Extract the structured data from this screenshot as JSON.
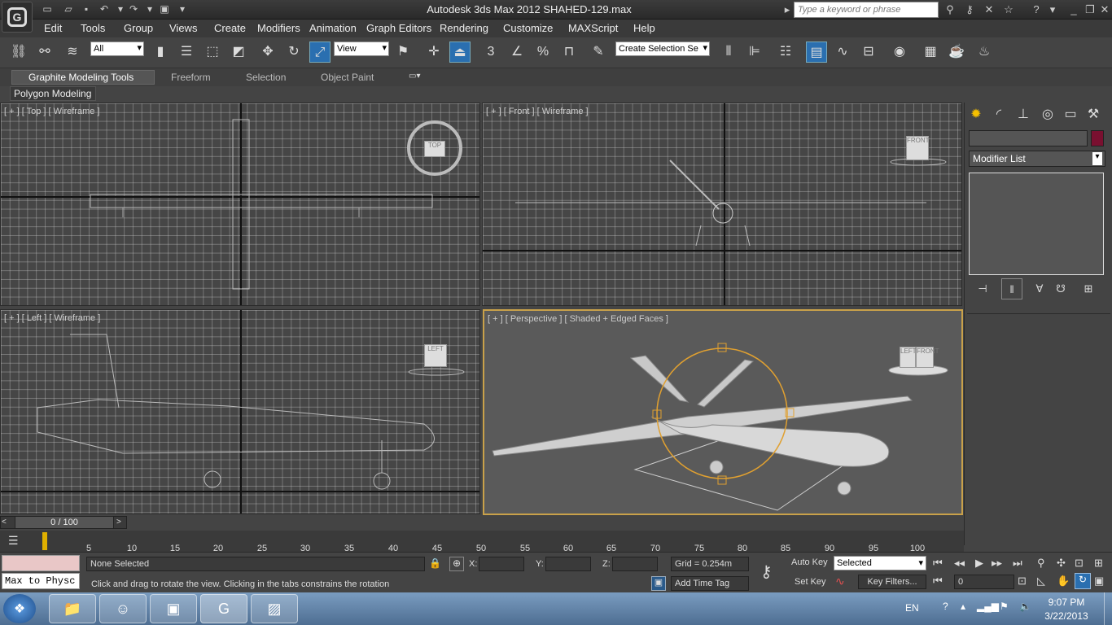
{
  "title": {
    "app": "Autodesk 3ds Max  2012",
    "file": "SHAHED-129.max",
    "search_placeholder": "Type a keyword or phrase"
  },
  "menu": [
    "Edit",
    "Tools",
    "Group",
    "Views",
    "Create",
    "Modifiers",
    "Animation",
    "Graph Editors",
    "Rendering",
    "Customize",
    "MAXScript",
    "Help"
  ],
  "toolbar": {
    "selection_filter": "All",
    "ref_coord": "View",
    "named_selection": "Create Selection Se"
  },
  "ribbon": {
    "tabs": [
      "Graphite Modeling Tools",
      "Freeform",
      "Selection",
      "Object Paint"
    ],
    "panel": "Polygon Modeling"
  },
  "viewports": {
    "top": "[ + ] [ Top ] [ Wireframe ]",
    "front": "[ + ] [ Front ] [ Wireframe ]",
    "left": "[ + ] [ Left ] [ Wireframe ]",
    "perspective": "[ + ] [ Perspective ] [ Shaded + Edged Faces ]",
    "cube_top": "TOP",
    "cube_front": "FRONT",
    "cube_left": "LEFT",
    "cube_persp_a": "LEFT",
    "cube_persp_b": "FRONT"
  },
  "command_panel": {
    "modifier_list": "Modifier List"
  },
  "timeline": {
    "frame": "0 / 100",
    "ticks": [
      "5",
      "10",
      "15",
      "20",
      "25",
      "30",
      "35",
      "40",
      "45",
      "50",
      "55",
      "60",
      "65",
      "70",
      "75",
      "80",
      "85",
      "90",
      "95",
      "100"
    ]
  },
  "status": {
    "maxscript": "Max to Physc",
    "selection": "None Selected",
    "prompt": "Click and drag to rotate the view.  Clicking in the tabs constrains the rotation",
    "x_label": "X:",
    "y_label": "Y:",
    "z_label": "Z:",
    "grid": "Grid = 0.254m",
    "add_time_tag": "Add Time Tag",
    "auto_key": "Auto Key",
    "set_key": "Set Key",
    "key_mode": "Selected",
    "key_filters": "Key Filters...",
    "current_frame": "0"
  },
  "tray": {
    "lang": "EN",
    "time": "9:07 PM",
    "date": "3/22/2013"
  },
  "colors": {
    "accent": "#e0a030",
    "selection_swatch": "#7a1030"
  }
}
